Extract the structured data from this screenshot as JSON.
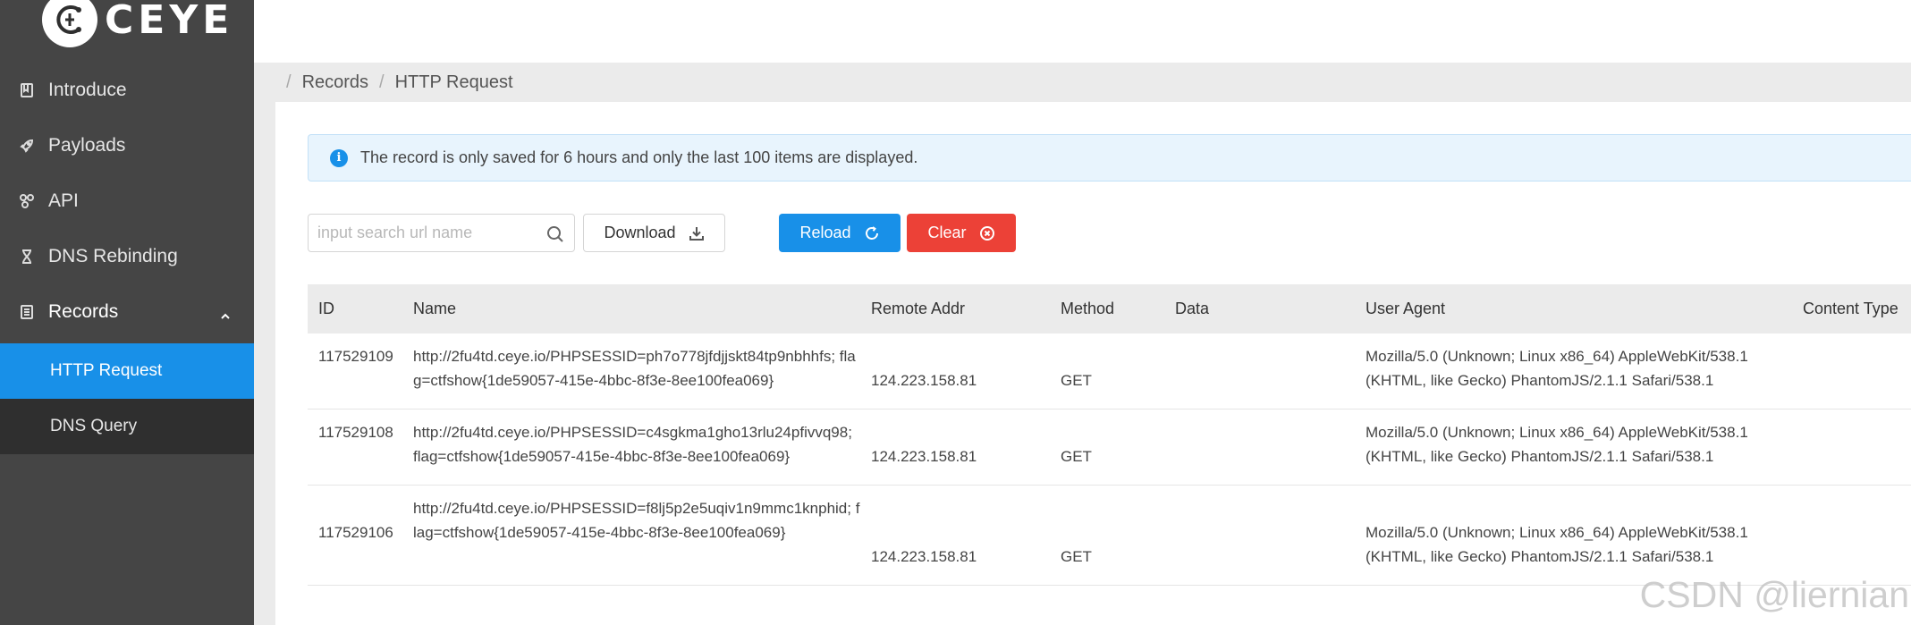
{
  "sidebar": {
    "logo_text": "CEYE",
    "items": [
      {
        "label": "Introduce",
        "icon": "book-icon"
      },
      {
        "label": "Payloads",
        "icon": "rocket-icon"
      },
      {
        "label": "API",
        "icon": "api-icon"
      },
      {
        "label": "DNS Rebinding",
        "icon": "hourglass-icon"
      },
      {
        "label": "Records",
        "icon": "document-icon"
      }
    ],
    "subitems": [
      {
        "label": "HTTP Request",
        "selected": true
      },
      {
        "label": "DNS Query",
        "selected": false
      }
    ]
  },
  "breadcrumb": [
    "Records",
    "HTTP Request"
  ],
  "alert": {
    "icon": "info-icon",
    "text": "The record is only saved for 6 hours and only the last 100 items are displayed."
  },
  "toolbar": {
    "search_placeholder": "input search url name",
    "download_label": "Download",
    "reload_label": "Reload",
    "clear_label": "Clear"
  },
  "table": {
    "columns": [
      "ID",
      "Name",
      "Remote Addr",
      "Method",
      "Data",
      "User Agent",
      "Content Type"
    ],
    "rows": [
      {
        "id": "117529109",
        "name": "http://2fu4td.ceye.io/PHPSESSID=ph7o778jfdjjskt84tp9nbhhfs; flag=ctfshow{1de59057-415e-4bbc-8f3e-8ee100fea069}",
        "remote_addr": "124.223.158.81",
        "method": "GET",
        "data": "",
        "user_agent": "Mozilla/5.0 (Unknown; Linux x86_64) AppleWebKit/538.1 (KHTML, like Gecko) PhantomJS/2.1.1 Safari/538.1",
        "content_type": ""
      },
      {
        "id": "117529108",
        "name": "http://2fu4td.ceye.io/PHPSESSID=c4sgkma1gho13rlu24pfivvq98; flag=ctfshow{1de59057-415e-4bbc-8f3e-8ee100fea069}",
        "remote_addr": "124.223.158.81",
        "method": "GET",
        "data": "",
        "user_agent": "Mozilla/5.0 (Unknown; Linux x86_64) AppleWebKit/538.1 (KHTML, like Gecko) PhantomJS/2.1.1 Safari/538.1",
        "content_type": ""
      },
      {
        "id": "117529106",
        "name": "http://2fu4td.ceye.io/PHPSESSID=f8lj5p2e5uqiv1n9mmc1knphid; flag=ctfshow{1de59057-415e-4bbc-8f3e-8ee100fea069}",
        "remote_addr": "124.223.158.81",
        "method": "GET",
        "data": "",
        "user_agent": "Mozilla/5.0 (Unknown; Linux x86_64) AppleWebKit/538.1 (KHTML, like Gecko) PhantomJS/2.1.1 Safari/538.1",
        "content_type": ""
      }
    ]
  },
  "watermark": "CSDN @liernian",
  "colors": {
    "sidebar_bg": "#454545",
    "submenu_bg": "#2f2f2f",
    "primary": "#1890e8",
    "danger": "#ec4137",
    "alert_bg": "#e8f4fd"
  }
}
